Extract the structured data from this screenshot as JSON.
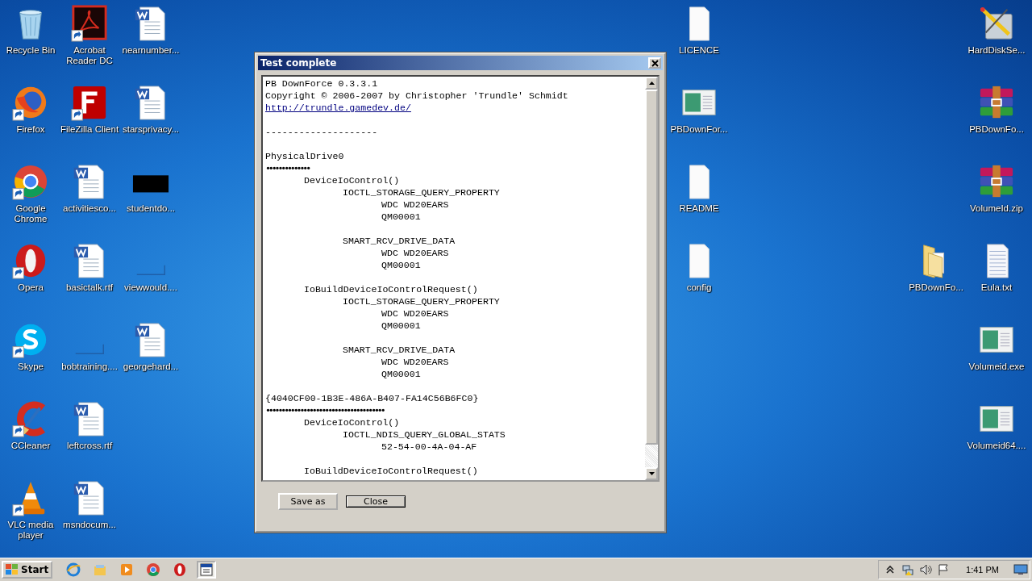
{
  "desktop": {
    "columns": [
      {
        "icons": [
          {
            "label": "Recycle Bin",
            "kind": "recycle",
            "shortcut": false
          },
          {
            "label": "Firefox",
            "kind": "firefox",
            "shortcut": true
          },
          {
            "label": "Google Chrome",
            "kind": "chrome",
            "shortcut": true
          },
          {
            "label": "Opera",
            "kind": "opera",
            "shortcut": true
          },
          {
            "label": "Skype",
            "kind": "skype",
            "shortcut": true
          },
          {
            "label": "CCleaner",
            "kind": "ccleaner",
            "shortcut": true
          },
          {
            "label": "VLC media player",
            "kind": "vlc",
            "shortcut": true
          }
        ]
      },
      {
        "icons": [
          {
            "label": "Acrobat Reader DC",
            "kind": "acrobat",
            "shortcut": true
          },
          {
            "label": "FileZilla Client",
            "kind": "filezilla",
            "shortcut": true
          },
          {
            "label": "activitiesco...",
            "kind": "word",
            "shortcut": false
          },
          {
            "label": "basictalk.rtf",
            "kind": "word",
            "shortcut": false
          },
          {
            "label": "bobtraining....",
            "kind": "blank",
            "shortcut": false
          },
          {
            "label": "leftcross.rtf",
            "kind": "word",
            "shortcut": false
          },
          {
            "label": "msndocum...",
            "kind": "word",
            "shortcut": false
          }
        ]
      },
      {
        "icons": [
          {
            "label": "nearnumber...",
            "kind": "word",
            "shortcut": false
          },
          {
            "label": "starsprivacy...",
            "kind": "word",
            "shortcut": false
          },
          {
            "label": "studentdo...",
            "kind": "redacted",
            "shortcut": false
          },
          {
            "label": "viewwould....",
            "kind": "blank",
            "shortcut": false
          },
          {
            "label": "georgehard...",
            "kind": "word",
            "shortcut": false
          }
        ]
      },
      {
        "icons": [
          {
            "label": "LICENCE",
            "kind": "file",
            "shortcut": false
          },
          {
            "label": "PBDownFor...",
            "kind": "exe",
            "shortcut": false
          },
          {
            "label": "README",
            "kind": "file",
            "shortcut": false
          },
          {
            "label": "config",
            "kind": "file",
            "shortcut": false
          }
        ]
      },
      {
        "icons": [
          {
            "label": "PBDownFo...",
            "kind": "folder",
            "shortcut": false
          }
        ]
      },
      {
        "icons": [
          {
            "label": "HardDiskSe...",
            "kind": "harddisk",
            "shortcut": false
          },
          {
            "label": "PBDownFo...",
            "kind": "winrar",
            "shortcut": false
          },
          {
            "label": "VolumeId.zip",
            "kind": "winrar",
            "shortcut": false
          },
          {
            "label": "Eula.txt",
            "kind": "text",
            "shortcut": false
          },
          {
            "label": "Volumeid.exe",
            "kind": "exe",
            "shortcut": false
          },
          {
            "label": "Volumeid64....",
            "kind": "exe",
            "shortcut": false
          }
        ]
      }
    ]
  },
  "dialog": {
    "title": "Test complete",
    "lines": [
      {
        "kind": "text",
        "text": "PB DownForce 0.3.3.1"
      },
      {
        "kind": "text",
        "text": "Copyright © 2006-2007 by Christopher 'Trundle' Schmidt"
      },
      {
        "kind": "link",
        "text": "http://trundle.gamedev.de/"
      },
      {
        "kind": "blank"
      },
      {
        "kind": "text",
        "text": "--------------------"
      },
      {
        "kind": "blank"
      },
      {
        "kind": "text",
        "text": "PhysicalDrive0"
      },
      {
        "kind": "dots",
        "text": "••••••••••••••"
      },
      {
        "kind": "text",
        "text": "\tDeviceIoControl()"
      },
      {
        "kind": "text",
        "text": "\t\tIOCTL_STORAGE_QUERY_PROPERTY"
      },
      {
        "kind": "text",
        "text": "\t\t\tWDC WD20EARS"
      },
      {
        "kind": "text",
        "text": "\t\t\tQM00001"
      },
      {
        "kind": "blank"
      },
      {
        "kind": "text",
        "text": "\t\tSMART_RCV_DRIVE_DATA"
      },
      {
        "kind": "text",
        "text": "\t\t\tWDC WD20EARS"
      },
      {
        "kind": "text",
        "text": "\t\t\tQM00001"
      },
      {
        "kind": "blank"
      },
      {
        "kind": "text",
        "text": "\tIoBuildDeviceIoControlRequest()"
      },
      {
        "kind": "text",
        "text": "\t\tIOCTL_STORAGE_QUERY_PROPERTY"
      },
      {
        "kind": "text",
        "text": "\t\t\tWDC WD20EARS"
      },
      {
        "kind": "text",
        "text": "\t\t\tQM00001"
      },
      {
        "kind": "blank"
      },
      {
        "kind": "text",
        "text": "\t\tSMART_RCV_DRIVE_DATA"
      },
      {
        "kind": "text",
        "text": "\t\t\tWDC WD20EARS"
      },
      {
        "kind": "text",
        "text": "\t\t\tQM00001"
      },
      {
        "kind": "blank"
      },
      {
        "kind": "text",
        "text": "{4040CF00-1B3E-486A-B407-FA14C56B6FC0}"
      },
      {
        "kind": "dots",
        "text": "••••••••••••••••••••••••••••••••••••••"
      },
      {
        "kind": "text",
        "text": "\tDeviceIoControl()"
      },
      {
        "kind": "text",
        "text": "\t\tIOCTL_NDIS_QUERY_GLOBAL_STATS"
      },
      {
        "kind": "text",
        "text": "\t\t\t52-54-00-4A-04-AF"
      },
      {
        "kind": "blank"
      },
      {
        "kind": "text",
        "text": "\tIoBuildDeviceIoControlRequest()"
      }
    ],
    "buttons": [
      {
        "label": "Save as",
        "focused": false
      },
      {
        "label": "Close",
        "focused": true
      }
    ]
  },
  "taskbar": {
    "start": "Start",
    "items": [
      {
        "kind": "ie",
        "selected": false
      },
      {
        "kind": "explorer",
        "selected": false
      },
      {
        "kind": "media",
        "selected": false
      },
      {
        "kind": "chrome",
        "selected": false
      },
      {
        "kind": "opera",
        "selected": false
      },
      {
        "kind": "app",
        "selected": true
      }
    ],
    "tray": [
      {
        "kind": "chevron"
      },
      {
        "kind": "network"
      },
      {
        "kind": "volume"
      },
      {
        "kind": "flag"
      }
    ],
    "time": "1:41 PM"
  }
}
